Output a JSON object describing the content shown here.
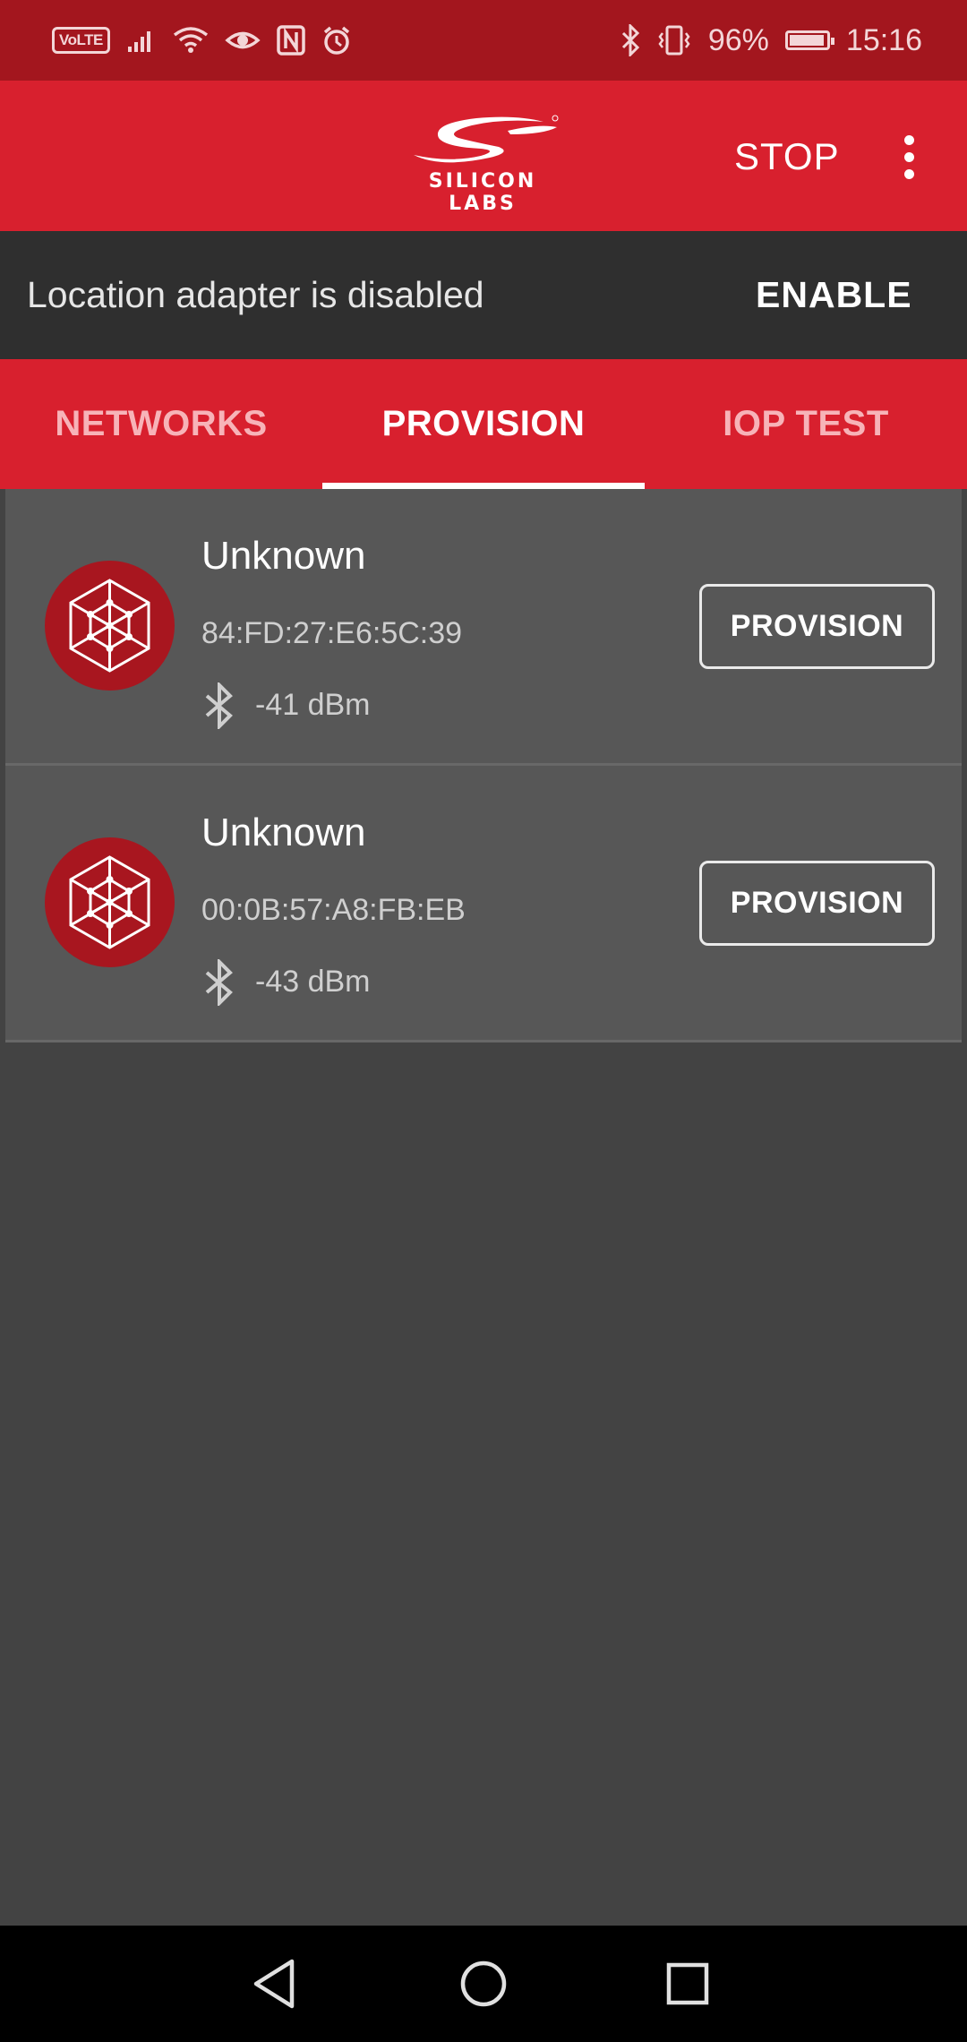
{
  "status_bar": {
    "volte": "VoLTE",
    "battery_percent": "96%",
    "time": "15:16",
    "icons": [
      "signal-icon",
      "wifi-icon",
      "eye-icon",
      "nfc-icon",
      "alarm-icon",
      "bluetooth-icon",
      "vibrate-icon",
      "battery-icon"
    ]
  },
  "app_bar": {
    "logo_text": "SILICON LABS",
    "stop_label": "STOP",
    "overflow_icon": "more-vert-icon"
  },
  "location_banner": {
    "message": "Location adapter is disabled",
    "action_label": "ENABLE"
  },
  "tabs": [
    {
      "label": "NETWORKS",
      "active": false
    },
    {
      "label": "PROVISION",
      "active": true
    },
    {
      "label": "IOP TEST",
      "active": false
    }
  ],
  "devices": [
    {
      "name": "Unknown",
      "address": "84:FD:27:E6:5C:39",
      "rssi": "-41 dBm",
      "button_label": "PROVISION"
    },
    {
      "name": "Unknown",
      "address": "00:0B:57:A8:FB:EB",
      "rssi": "-43 dBm",
      "button_label": "PROVISION"
    }
  ],
  "nav_bar": {
    "buttons": [
      "back-icon",
      "home-icon",
      "recents-icon"
    ]
  },
  "colors": {
    "brand_red": "#d8202e",
    "status_bar": "#a3161e",
    "banner": "#2f2f2f",
    "card": "#575757",
    "background": "#434343"
  }
}
